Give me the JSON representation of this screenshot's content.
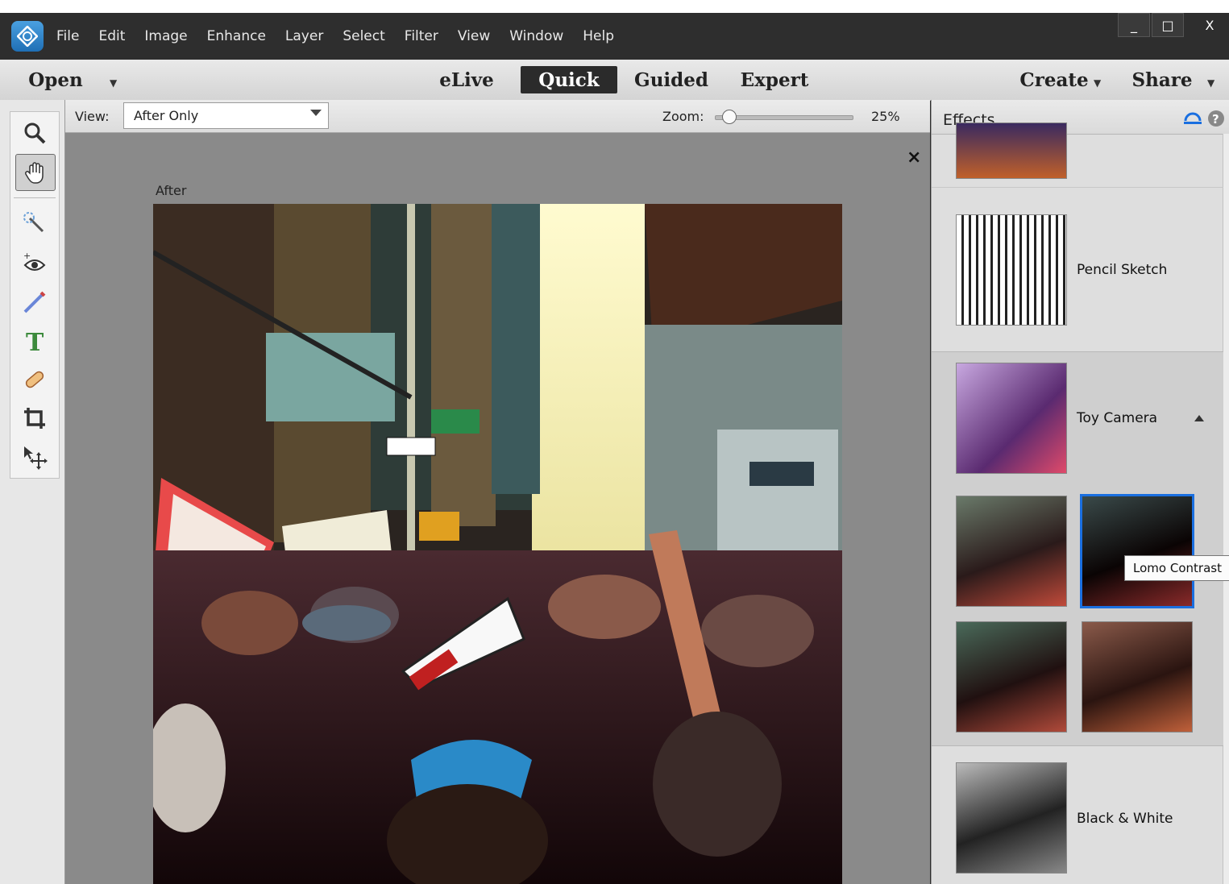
{
  "menu": [
    "File",
    "Edit",
    "Image",
    "Enhance",
    "Layer",
    "Select",
    "Filter",
    "View",
    "Window",
    "Help"
  ],
  "window_controls": {
    "minimize": "_",
    "maximize": "□",
    "close": "X"
  },
  "modebar": {
    "open": "Open",
    "modes": [
      "eLive",
      "Quick",
      "Guided",
      "Expert"
    ],
    "active_mode": "Quick",
    "create": "Create",
    "share": "Share"
  },
  "tools": [
    "zoom-tool",
    "hand-tool",
    "quick-selection-tool",
    "red-eye-tool",
    "whiten-teeth-tool",
    "type-tool",
    "spot-healing-tool",
    "crop-tool",
    "move-tool"
  ],
  "options": {
    "view_label": "View:",
    "view_value": "After Only",
    "zoom_label": "Zoom:",
    "zoom_value": "25%",
    "zoom_fraction": 0.05
  },
  "canvas": {
    "after_label": "After",
    "close": "×"
  },
  "effects": {
    "title": "Effects",
    "items": [
      {
        "label": "Pencil Sketch"
      },
      {
        "label": "Toy Camera"
      },
      {
        "label": "Black & White"
      }
    ],
    "tooltip": "Lomo Contrast"
  },
  "colors": {
    "accent": "#1a6fe0",
    "menubar": "#2e2e2e",
    "canvas": "#8a8a8a"
  }
}
